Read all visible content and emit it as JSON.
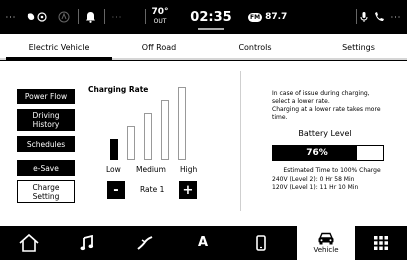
{
  "status_bar": {
    "left_dots": "···",
    "separator_dots": "···",
    "temperature": "70°",
    "temperature_unit": "OUT",
    "time": "02:35",
    "radio_band": "FM",
    "radio_frequency": "87.7",
    "right_dots": "···"
  },
  "tabs": [
    {
      "label": "Electric Vehicle",
      "active": true
    },
    {
      "label": "Off Road",
      "active": false
    },
    {
      "label": "Controls",
      "active": false
    },
    {
      "label": "Settings",
      "active": false
    }
  ],
  "side_menu": [
    {
      "label": "Power Flow",
      "active": false
    },
    {
      "label": "Driving History",
      "active": false
    },
    {
      "label": "Schedules",
      "active": false
    },
    {
      "label": "e-Save",
      "active": false
    },
    {
      "label": "Charge Setting",
      "active": true
    }
  ],
  "charging": {
    "title": "Charging Rate",
    "levels": [
      "Low",
      "Medium",
      "High"
    ],
    "minus": "-",
    "plus": "+",
    "rate_label": "Rate 1",
    "selected_bars": 1,
    "total_bars": 5
  },
  "info_lines": [
    "In case of issue during charging,",
    "select a lower rate.",
    "Charging at a lower rate takes more",
    "time."
  ],
  "battery": {
    "title": "Battery Level",
    "percent_text": "76%",
    "level": 0.76,
    "estimate_title": "Estimated Time to 100% Charge",
    "eta_240": "240V (Level 2):  0 Hr 58 Min",
    "eta_120": "120V (Level 1):  11 Hr 10 Min"
  },
  "bottom_nav": {
    "vehicle_label": "Vehicle",
    "apps_letter": "A"
  }
}
